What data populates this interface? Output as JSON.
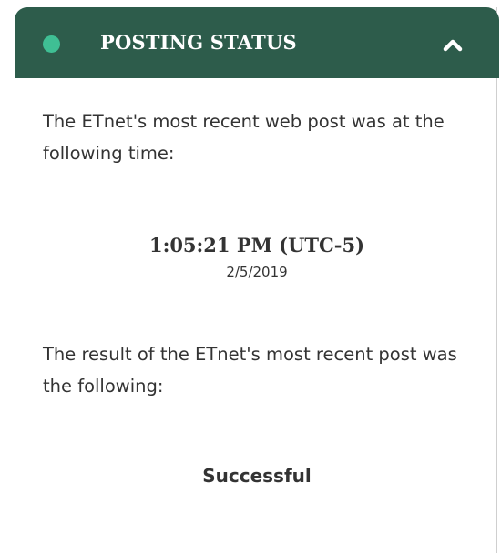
{
  "header": {
    "title": "POSTING STATUS",
    "status_color": "#3fbf94",
    "header_color": "#2d5c4b",
    "toggle_icon": "chevron-up-icon"
  },
  "last_post": {
    "description": "The ETnet's most recent web post was at the following time:",
    "time": "1:05:21 PM (UTC-5)",
    "date": "2/5/2019"
  },
  "last_result": {
    "description": "The result of the ETnet's most recent post was the following:",
    "status": "Successful"
  }
}
